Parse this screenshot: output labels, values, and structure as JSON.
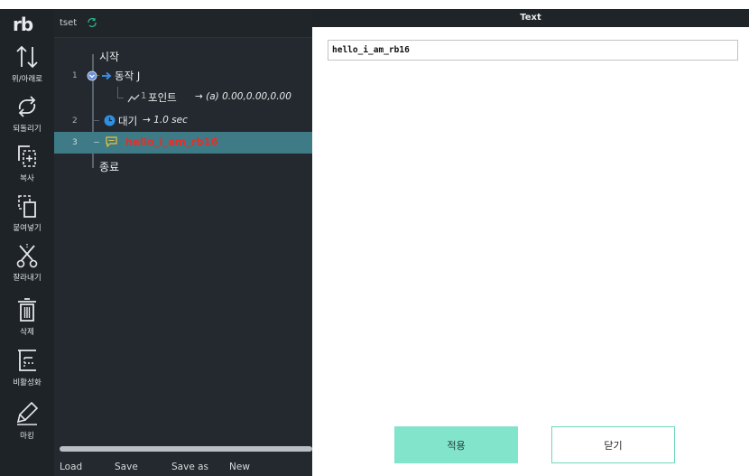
{
  "app": {
    "logo": "rb",
    "program_name": "tset"
  },
  "toolbar": {
    "items": [
      {
        "label": "위/아래로",
        "icon": "move-up-down-icon"
      },
      {
        "label": "되돌리기",
        "icon": "undo-icon"
      },
      {
        "label": "복사",
        "icon": "copy-icon"
      },
      {
        "label": "붙여넣기",
        "icon": "paste-icon"
      },
      {
        "label": "잘라내기",
        "icon": "cut-icon"
      },
      {
        "label": "삭제",
        "icon": "delete-icon"
      },
      {
        "label": "비활성화",
        "icon": "disable-icon"
      },
      {
        "label": "마킹",
        "icon": "marking-icon"
      }
    ]
  },
  "tree": {
    "start": "시작",
    "end": "종료",
    "rows": [
      {
        "line": "1",
        "text": "동작 J"
      },
      {
        "line": "",
        "index": "1",
        "text": "포인트",
        "detail": "→ (a) 0.00,0.00,0.00"
      },
      {
        "line": "2",
        "text": "대기",
        "detail": "→ 1.0 sec"
      },
      {
        "line": "3",
        "text": "hello_i_am_rb16"
      }
    ]
  },
  "bottom": {
    "load": "Load",
    "save": "Save",
    "save_as": "Save as",
    "new": "New"
  },
  "panel": {
    "title": "Text",
    "field_value": "hello_i_am_rb16",
    "apply_label": "적용",
    "close_label": "닫기"
  },
  "colors": {
    "toolbar_bg": "#1d2327",
    "editor_bg": "#23292e",
    "selected_row": "#3e7b86",
    "accent_teal": "#83e4cc",
    "comment_red": "#e0312b",
    "wait_blue": "#2f8fe0",
    "move_blue": "#3a8be0"
  }
}
